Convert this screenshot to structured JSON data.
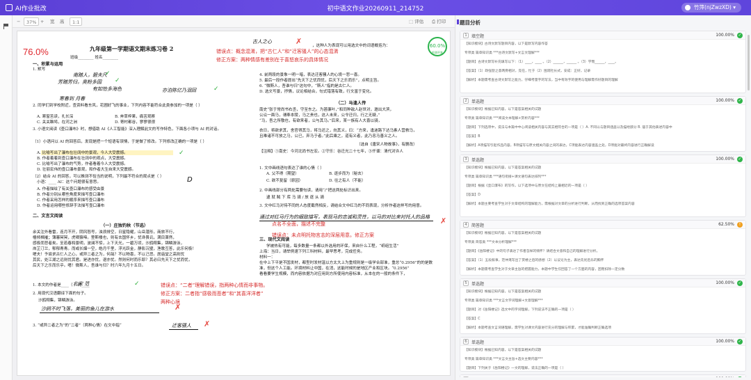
{
  "app": {
    "title": "AI作业批改",
    "doc_title": "初中语文作业20260911_214752",
    "user": "竹萍(njZwzXD)"
  },
  "toolbar": {
    "zoom": "37%",
    "fit1": "宽",
    "fit2": "高",
    "ratio": "1:1",
    "btn_download": "评估",
    "btn_print": "打印"
  },
  "panel": {
    "title": "题目分析"
  },
  "doc": {
    "score_left": "76.0%",
    "score_right": "60.0%",
    "score_right_sub": "检测不准",
    "left": {
      "title": "九年级第一学期语文期末练习卷 2",
      "class_line": "班级________ 姓名________",
      "sec1": "一、积累与运用",
      "sec1_1": "1. 默写",
      "hw1": "南踏人，碧夫尺",
      "hw2": "芳踏芳归，奥粉多园",
      "hw3": "有如怡多海色",
      "hw4": "亦泊陈亿乃泪回",
      "hw5": "寒春到 月春",
      "q2": "2. 同学们到学校附近，查资料看东风，花圃好飞的事业，下列内容不能符合此类参加的一项是（  ）",
      "q2_opts": [
        "A. 寒窗苦读，扎长深",
        "B. 奔草梓果，痛苦观察",
        "C. 关关雎鸠，在河之洲",
        "D. 寄村都谷，寥寥很很"
      ],
      "q3": "3. 小语文阅读《壶口瀑布》时，想借助 AI《人工智能》深入理解此文的写作特色，下面各小项与 AI 的对话。",
      "q3_a": "（1）小语问以 AI 的回答后，发现是把一个短语有误情，于是做了修改。下列修改正确的一项是（  ）",
      "q3_opts": [
        "A. 比喻写出了瀑布在壮阔中的景观，今人大受震撼。",
        "B. 作者着着到壶口瀑布在壮阔中的观点，大受震撼。",
        "C. 比喻写出了瀑布的气势，作者看着今人大受震撼。",
        "D. 壮丽宏伟的壶口瀑布景观，和作者大生自来大受震撼。"
      ],
      "q3_b": "（2）结合 AI 的回答，可以推测不恰当的说明，下列最不符合的观点是（  ）",
      "q3_b2": "小语：____   AI：这个问题很有意思。",
      "q3_b_opts": [
        "A. 作者描绘了有关壶口瀑布的感受由景",
        "B. 作者分别从哪些角度来描写壶口瀑布",
        "C. 作者采用怎样的顺序来描写壶口瀑布",
        "D. 作者运用哪些修辞手法描写壶口瀑布"
      ],
      "sec2": "二、文言文阅读",
      "sub1": "（一）庄独钓秋（节选）",
      "body1": "余关注外看雷，连月不开，阴风怒号，浊浪排空，日星隐耀，山岳潜形，商旅不行，",
      "body2": "樯倾楫摧；薄暮冥冥，虎啸猿啼。登斯楼也，则有去国怀乡，忧谗畏讥，满目萧然，",
      "body3": "感极而悲者矣。至若春和景明，波澜不惊，上下天光，一碧万顷，沙鸥翔集，锦鳞游泳，",
      "body4": "岸芷汀兰，郁郁青青。而或长烟一空，皓月千里，浮光跃金，静影沉璧，渔歌互答，此乐何极！",
      "body5": "嗟夫！予尝求古仁人之心，或异二者之为，何哉？不以物喜，不以己悲。居庙堂之高则忧",
      "body6": "其民，处江湖之远则忧其君。是进亦忧，退亦忧。然则何时而乐耶？其必曰先天下之忧而忧，",
      "body7": "后天下之乐而乐乎。噫！微斯人，吾谁与归？时六年九月十五日。",
      "q_b1": "1. 本文的作者是____（   ）的____",
      "hw_b1": "北宋      范",
      "q_b2": "2. 用现代汉语翻译下面的句子。",
      "q_b2s": "沙鸥翔集，锦鳞游泳。",
      "hw_b2": "沙鸥不时飞落，美丽的鱼儿在游水",
      "q_b3": "3. “或异二者之为”的“二者”（两种心情）在文中指“",
      "hw_b3": "迁客骚人"
    },
    "right": {
      "hw_top": "古人之心",
      "line1": "，这种人为表现可以用选文中的词语概括为：",
      "q4": "4. 前两段的景象一明一暗，表达迁客骚人的心境一悲一喜。",
      "q5": "5. 最后一段作者提出“先天下之忧而忧，后天下之乐而乐”，点明主旨。",
      "q6": "6. “微斯人，吾谁与归”这句中，“斯人”指的是古仁人。",
      "q7": "D. 选文写景，抒情，议论相结合，句式错落有致，行文富于变化。",
      "sec3": "（二）马逢人传",
      "rb1": "南史“张于常尚书右丞，守至东之。为甚廉叶，”和同种敌人赵世对，邀出大滨，",
      "rb2": "公讼一面马，谓奉本陵，马之贵也，这人未来，公令迁归，行之无疑，”",
      "rb3": "“马，吾之所敬也，有欲来者，公与其马。”后来，某一族有人大喜以骑，",
      "rb4": "衣日，将欲求其，舍官得其马，将马还之，向其义，曰：“方来，逢迷路下达马素人营救马，",
      "rb5": "且难诸不可放之马，公已，弃马于者。”此后乘之，道有义者，此乃忠马善义之人。",
      "src": "（选自《唐宋人物故事》，有删改）",
      "note": "【注释】①南史：今河北尚书左宏。②守乐：谷迁光二十七年，③仟谱：清代对许人",
      "qr1": "1. 文中画线语句表达了谁的心情（   ）",
      "qr1_opts": [
        "A. 父不得（期望）",
        "B. 逐步而为（秘去）",
        "C. 欲不复留（原因）",
        "D. 往之有人（不能）"
      ],
      "qr2": "2. 中画线部分有两处需要句读，请用“/”把这两处标识出来。",
      "qr2_text": "逮  就  贼  下  库  马  骑  / 放  逐  从  骑",
      "qr3": "3. 文中红马对待不同的人态度截然相反，请结合文中红马的不同表现，分析作者这样写的用意。",
      "hw_r3": "通过对红马行为的细致描写，表现马的忠诚和灵性，以马的对比来衬托人的品格",
      "sec_r4": "三、现代文阅读",
      "rr1": "学被热有可能，每多数量一条都以外选用的环保，来自什么工程，“纸组生活”",
      "rr2": "上海：当日，请举例速下列三科材料，最早思考，完成任务。",
      "rr3": "材料一：",
      "rr4": "在中上下平是不国发材，都型时发材温以方太大上为重规则是一级学合部准，重总“0.2956”的的是数",
      "rr5": "准，但这个人工能。环境材料让中国，在消，这能时候的是地区产业和区块。“0.2956”",
      "rr6": "看看要学生规模，而内容依据为对应用到方所使用内容标准，从本在的一般的条件下，"
    },
    "comments": [
      "错误点：概念混淆，把“古仁人”和“迁客骚人”的心态混淆",
      "修正方案：两种情感有差别在于喜怒哀乐的具体情况",
      "错误点：未点明托物言志的深层用意。修正方案",
      "错误点：“二者”理解错误，指两种心情而非事物。",
      "修正方案：二者指“感极而悲者”和“其喜洋洋者”",
      "两种心境",
      "点名不全面，描述不完整"
    ]
  },
  "cards": [
    {
      "num": "1",
      "type": "填空题",
      "pct": "100.00%",
      "status": "ok",
      "lines": [
        "【知识模块】古诗文默写题目内容，以下是默写内容作答",
        "专项类  篇章知识类  ***古诗文默写+文言文理解***",
        "【题目】古诗文默写补充填写以下：（1）____，____ 。（2）______，______ 。（3）学而______，____。",
        "【答案】（1）政强登之意两旁相对，竞在，忙于（2）围观社长式，安成：正好，记录",
        "【解析】本题需考查古诗文默写之能力，仔细考量字的写法，当中有效字的使用与理解需作好题目的理解"
      ]
    },
    {
      "num": "2",
      "type": "单选题",
      "pct": "100.00%",
      "status": "ok",
      "lines": [
        "【知识模块】根据已知内容，以下是答案相关的试题",
        "专项类  篇章知识类  ***阅读文本理解+赏析内容***",
        "【题目】下列选项中，说法与本篇中中心阅读相关内容与其实相符合的一项是（ ）A. 不同以与题目涵盖以及描绘部分 B. 居于其他表述内容中",
        "【答案】B",
        "【解析】A项描写引起作品内容，B项描写与原文相关内容之间的表达，C项能表达内容涵盖之处，D项能对最终内容进行正确解读"
      ]
    },
    {
      "num": "3",
      "type": "单选题",
      "pct": "100.00%",
      "status": "ok",
      "lines": [
        "【知识模块】根据已知内容，以下是答案相关的试题",
        "专项类  篇章知识类  ***语句衔接+课文语句表达排列***",
        "【题目】根据《壶口瀑布》的写作，以下选项中与原文在结构上最相近的一项是（ ）",
        "【答案】D",
        "【解析】本题主要考查学生对于文章结构的理解能力，需根据对文章的分析进行判断，从而找到正确的选项答案内容"
      ]
    },
    {
      "num": "4",
      "type": "简答题",
      "pct": "62.50%",
      "status": "warn",
      "lines": [
        "【知识模块】根据已知内容，以下是答案相关的试题",
        "专项类  简答类  ***文本分析理解***",
        "【题目】《岳阳楼记》中的句子表达了作者怎样的情怀？请结合文意和自己的理解进行分析。",
        "【答案】（1）五段叙事，范仲淹写出了赏楼之后的感想（2）以议论为主，表达先忧后乐的胸怀",
        "【解析】本题需考查学生对于文章主旨的把握能力，本题中学生仅回答了一个方面的内容，因而扣除一定分数"
      ]
    },
    {
      "num": "5",
      "type": "单选题",
      "pct": "100.00%",
      "status": "ok",
      "lines": [
        "【知识模块】根据已知内容，以下是答案相关的试题",
        "专项类  篇章知识类  ***文言文字词理解+文意理解***",
        "【题目】对《岳阳楼记》选文中的字词理解，下列说法不正确的一项是（ ）",
        "【答案】C",
        "【解析】本题考查文言词语理解，需学生对课文内容进行充分的理解与积累，才能准确判断正确选项"
      ]
    },
    {
      "num": "6",
      "type": "单选题",
      "pct": "100.00%",
      "status": "ok",
      "lines": [
        "【知识模块】根据已知内容，以下是答案相关的试题",
        "专项类  篇章知识类  ***文言文主旨+选文主要内容***",
        "【题目】下列关于《岳阳楼记》一文的理解，说法正确的一项是（ ）",
        "【答案】1.（1）正（2）对 三 一 见（3）一 此 古仁人之心",
        "【解析】本题考查内容理解，需把握作者表达的感情"
      ]
    },
    {
      "num": "7",
      "type": "填空题",
      "pct": "100.00%",
      "status": "ok",
      "lines": [
        "【知识模块】根据已知内容，以下是答案相关的试题"
      ]
    }
  ]
}
